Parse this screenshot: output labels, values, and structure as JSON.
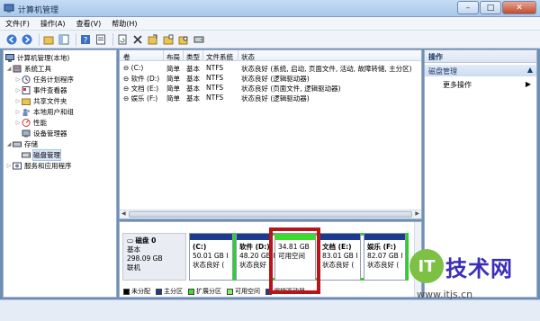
{
  "window": {
    "title": "计算机管理",
    "minimize": "–",
    "maximize": "□",
    "close": "✕"
  },
  "menu": [
    "文件(F)",
    "操作(A)",
    "查看(V)",
    "帮助(H)"
  ],
  "tree": {
    "root": "计算机管理(本地)",
    "system_tools": "系统工具",
    "task_scheduler": "任务计划程序",
    "event_viewer": "事件查看器",
    "shared_folders": "共享文件夹",
    "local_users": "本地用户和组",
    "performance": "性能",
    "device_manager": "设备管理器",
    "storage": "存储",
    "disk_management": "磁盘管理",
    "services_apps": "服务和应用程序"
  },
  "volumes": {
    "headers": [
      "卷",
      "布局",
      "类型",
      "文件系统",
      "状态"
    ],
    "rows": [
      {
        "name": "(C:)",
        "layout": "简单",
        "type": "基本",
        "fs": "NTFS",
        "status": "状态良好 (系统, 启动, 页面文件, 活动, 故障转储, 主分区)"
      },
      {
        "name": "软件 (D:)",
        "layout": "简单",
        "type": "基本",
        "fs": "NTFS",
        "status": "状态良好 (逻辑驱动器)"
      },
      {
        "name": "文档 (E:)",
        "layout": "简单",
        "type": "基本",
        "fs": "NTFS",
        "status": "状态良好 (页面文件, 逻辑驱动器)"
      },
      {
        "name": "娱乐 (F:)",
        "layout": "简单",
        "type": "基本",
        "fs": "NTFS",
        "status": "状态良好 (逻辑驱动器)"
      }
    ]
  },
  "disk": {
    "name": "磁盘 0",
    "type": "基本",
    "size": "298.09 GB",
    "state": "联机",
    "partitions": [
      {
        "name": "(C:)",
        "size": "50.01 GB I",
        "status": "状态良好 (",
        "color": "#1d3b8c"
      },
      {
        "name": "软件 (D:)",
        "size": "48.20 GB I",
        "status": "状态良好 (",
        "color": "#1d3b8c"
      },
      {
        "name": "",
        "size": "34.81 GB",
        "status": "可用空间",
        "color": "#3ddb2e"
      },
      {
        "name": "文档 (E:)",
        "size": "83.01 GB I",
        "status": "状态良好 (",
        "color": "#1d3b8c"
      },
      {
        "name": "娱乐 (F:)",
        "size": "82.07 GB I",
        "status": "状态良好 (",
        "color": "#1d3b8c"
      }
    ]
  },
  "legend": [
    {
      "label": "未分配",
      "color": "#000000"
    },
    {
      "label": "主分区",
      "color": "#1d3b8c"
    },
    {
      "label": "扩展分区",
      "color": "#3ddb2e"
    },
    {
      "label": "可用空间",
      "color": "#7cf061"
    },
    {
      "label": "逻辑驱动器",
      "color": "#1d3b8c"
    }
  ],
  "actions": {
    "header": "操作",
    "section": "磁盘管理",
    "more": "更多操作"
  },
  "watermark": {
    "logo": "IT",
    "brand": "技术网",
    "url": "www.itjs.cn"
  }
}
